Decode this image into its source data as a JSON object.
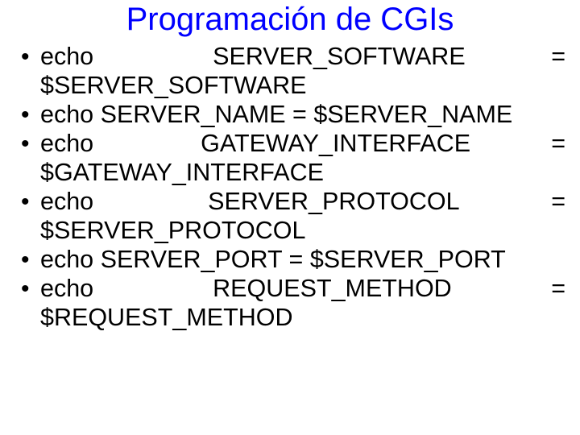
{
  "title": "Programación de CGIs",
  "items": [
    {
      "pre": "echo",
      "gap": "g1",
      "mid": "SERVER_SOFTWARE",
      "eq": "=",
      "cont": "$SERVER_SOFTWARE"
    },
    {
      "single": "echo SERVER_NAME = $SERVER_NAME"
    },
    {
      "pre": "echo",
      "gap": "g2",
      "mid": "GATEWAY_INTERFACE",
      "eq": "=",
      "cont": "$GATEWAY_INTERFACE"
    },
    {
      "pre": "echo",
      "gap": "g3",
      "mid": "SERVER_PROTOCOL",
      "eq": "=",
      "cont": "$SERVER_PROTOCOL"
    },
    {
      "single": "echo SERVER_PORT = $SERVER_PORT"
    },
    {
      "pre": "echo",
      "gap": "g4",
      "mid": "REQUEST_METHOD",
      "eq": "=",
      "cont": "$REQUEST_METHOD"
    }
  ]
}
